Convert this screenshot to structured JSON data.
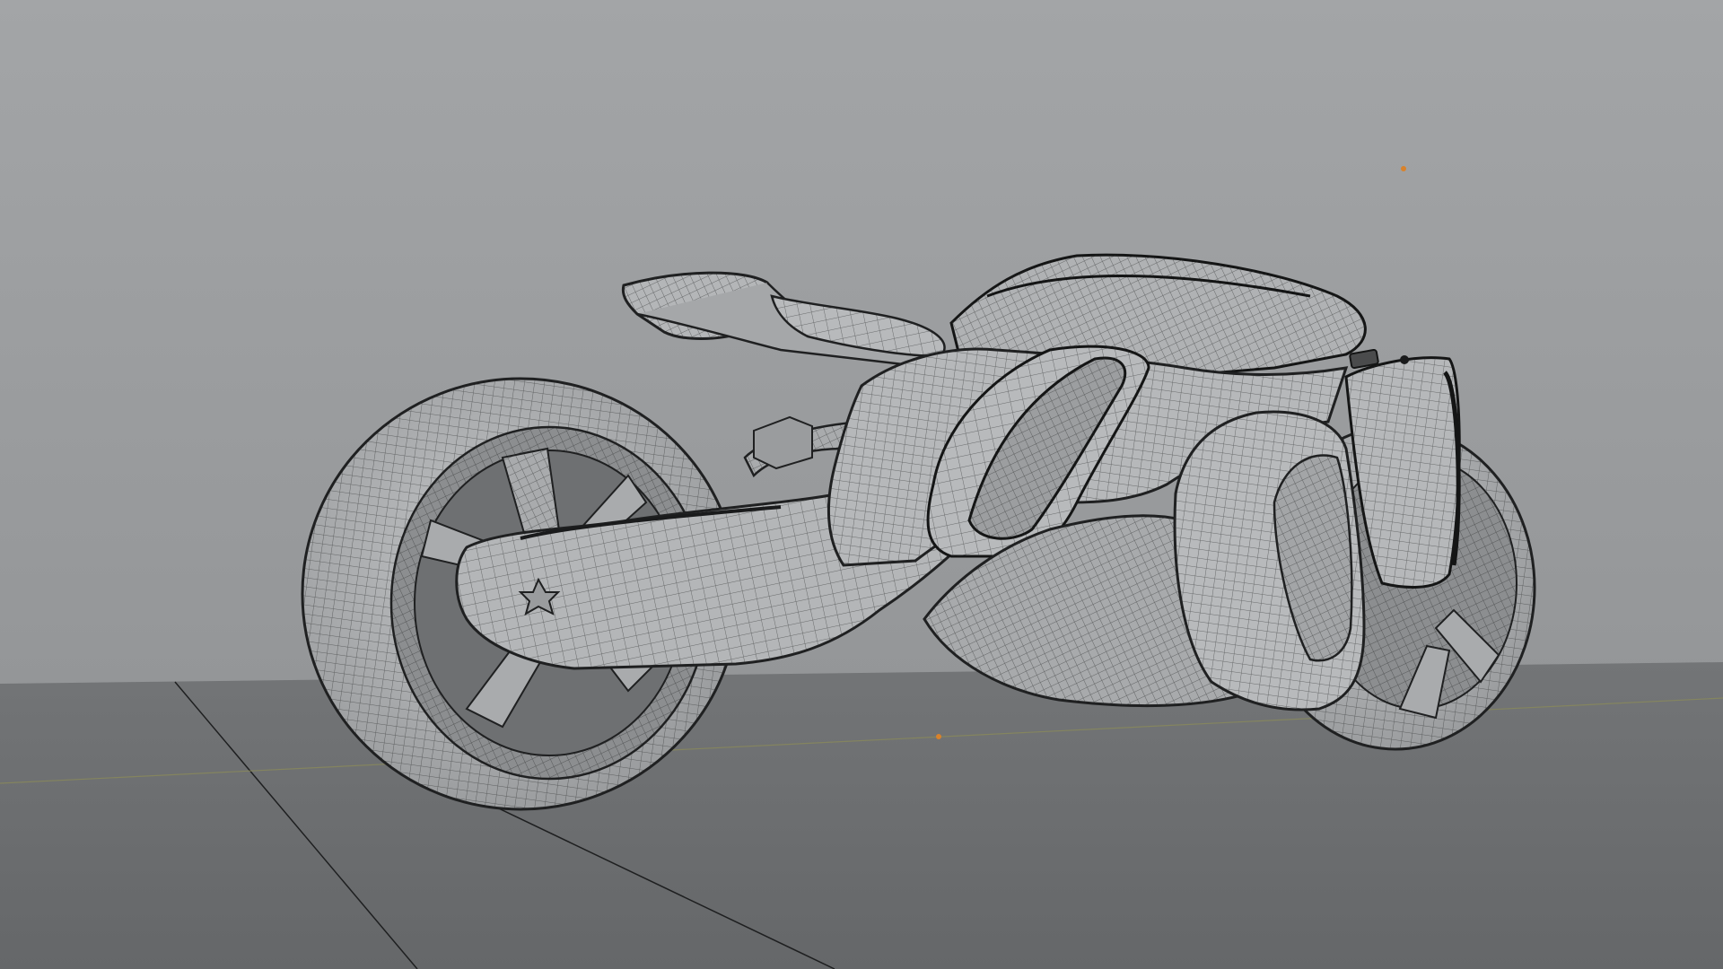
{
  "scene": {
    "view": "3d-viewport",
    "display_mode": "wireframe-on-solid",
    "object": "sci-fi-motorcycle-mesh",
    "colors": {
      "background_top": "#a3a5a7",
      "background_bottom": "#8e9092",
      "floor": "#6d6f71",
      "mesh_fill": "#b4b6b8",
      "mesh_shade": "#8f9193",
      "wire": "#2a2b2c",
      "light_marker": "#d9822b",
      "axis_line": "#8a8a5a"
    },
    "markers": [
      "light-point-marker",
      "origin-marker"
    ]
  }
}
